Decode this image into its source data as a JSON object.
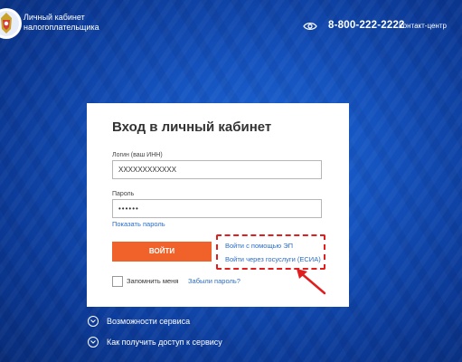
{
  "header": {
    "brand_line1": "Личный кабинет",
    "brand_line2": "налогоплательщика",
    "phone": "8-800-222-2222",
    "contact_center": "Контакт-центр"
  },
  "login_card": {
    "title": "Вход в личный кабинет",
    "login_label": "Логин (ваш ИНН)",
    "login_value": "XXXXXXXXXXXX",
    "password_label": "Пароль",
    "password_value": "••••••",
    "show_password": "Показать пароль",
    "submit": "ВОЙТИ",
    "alt_signature": "Войти с помощью ЭП",
    "alt_gosuslugi": "Войти через госуслуги (ЕСИА)",
    "remember_me": "Запомнить меня",
    "forgot_password": "Забыли пароль?"
  },
  "bottom_links": [
    {
      "label": "Возможности сервиса",
      "icon": "chevron-down-icon"
    },
    {
      "label": "Как получить доступ к сервису",
      "icon": "chevron-down-icon"
    }
  ],
  "colors": {
    "background": "#1553bf",
    "accent_button": "#f0622a",
    "link": "#2a6cc6",
    "highlight": "#e11d1d"
  }
}
